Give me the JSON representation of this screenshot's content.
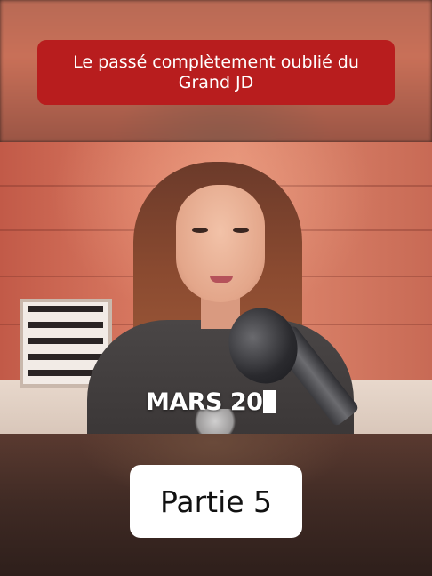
{
  "title_banner": {
    "text": "Le passé complètement oublié du Grand JD",
    "background": "#b81d1e"
  },
  "video": {
    "caption": "MARS 20"
  },
  "part_label": {
    "text": "Partie 5"
  }
}
